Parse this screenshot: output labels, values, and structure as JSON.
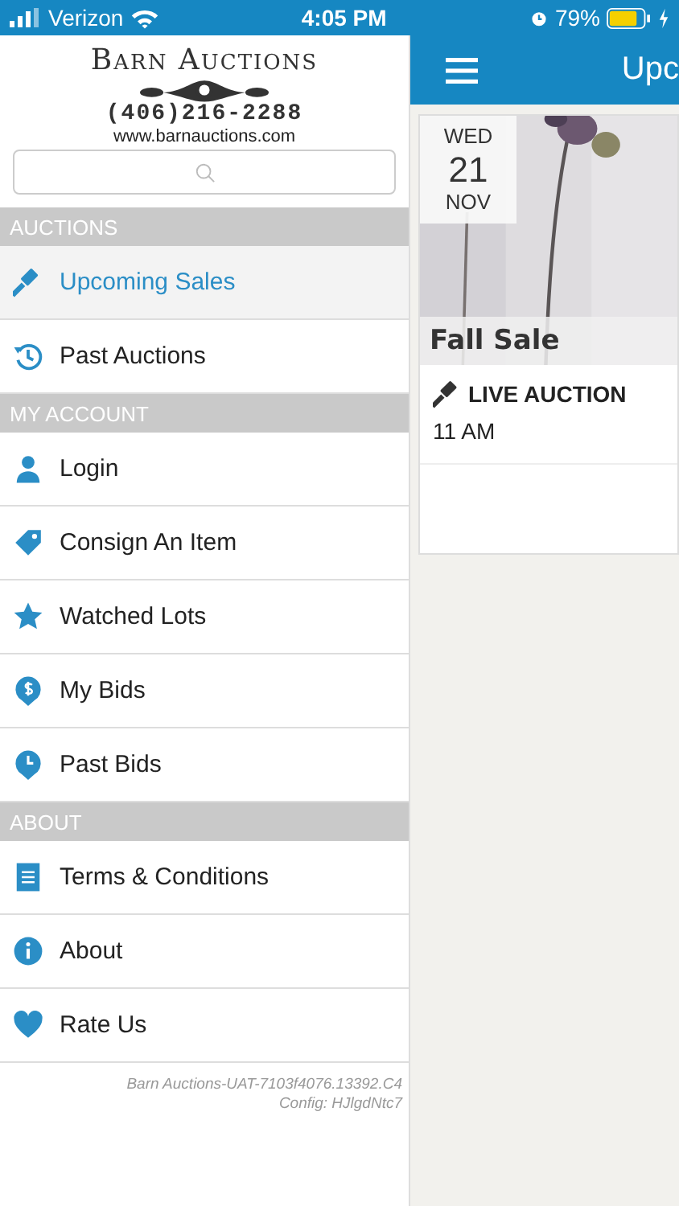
{
  "status_bar": {
    "carrier": "Verizon",
    "time": "4:05 PM",
    "battery": "79%"
  },
  "drawer": {
    "logo": {
      "name": "Barn Auctions",
      "phone": "(406)216-2288",
      "url": "www.barnauctions.com"
    },
    "sections": [
      {
        "title": "AUCTIONS",
        "items": [
          {
            "label": "Upcoming Sales",
            "kind": "gavel",
            "selected": true
          },
          {
            "label": "Past Auctions",
            "kind": "history",
            "selected": false
          }
        ]
      },
      {
        "title": "MY ACCOUNT",
        "items": [
          {
            "label": "Login",
            "kind": "person",
            "selected": false
          },
          {
            "label": "Consign An Item",
            "kind": "tag",
            "selected": false
          },
          {
            "label": "Watched Lots",
            "kind": "star",
            "selected": false
          },
          {
            "label": "My Bids",
            "kind": "dollar",
            "selected": false
          },
          {
            "label": "Past Bids",
            "kind": "clock",
            "selected": false
          }
        ]
      },
      {
        "title": "ABOUT",
        "items": [
          {
            "label": "Terms & Conditions",
            "kind": "document",
            "selected": false
          },
          {
            "label": "About",
            "kind": "info",
            "selected": false
          },
          {
            "label": "Rate Us",
            "kind": "heart",
            "selected": false
          }
        ]
      }
    ],
    "footer": [
      "Barn Auctions-UAT-7103f4076.13392.C4",
      "Config: HJlgdNtc7"
    ]
  },
  "main": {
    "title": "Upc",
    "sales": [
      {
        "weekday": "WED",
        "day": "21",
        "month": "NOV",
        "title": "Fall Sale",
        "type": "LIVE AUCTION",
        "time": "11 AM"
      }
    ]
  }
}
